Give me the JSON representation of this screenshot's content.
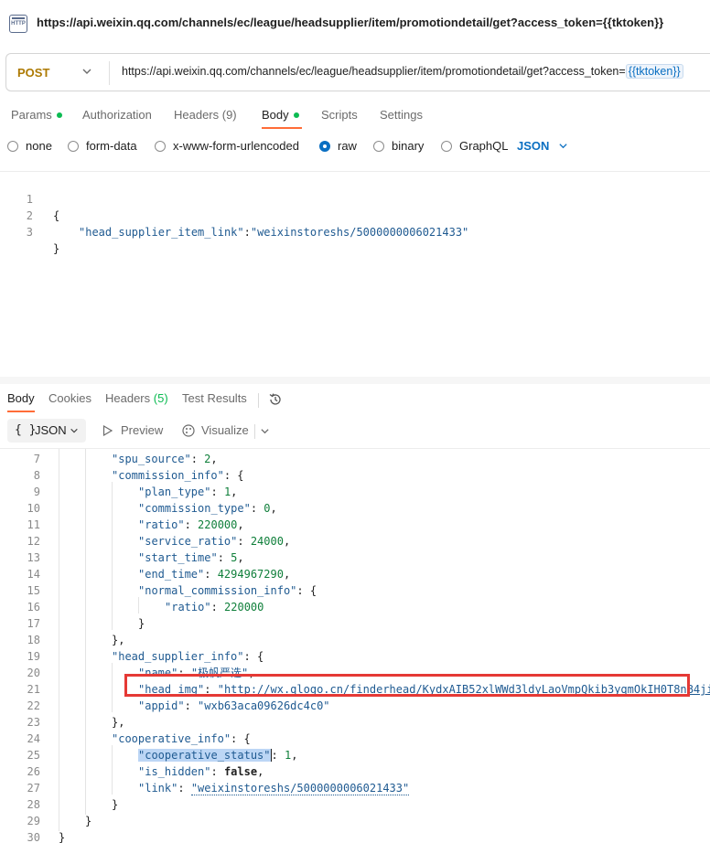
{
  "title": {
    "url": "https://api.weixin.qq.com/channels/ec/league/headsupplier/item/promotiondetail/get?access_token={{tktoken}}"
  },
  "request": {
    "method": "POST",
    "url_prefix": "https://api.weixin.qq.com/channels/ec/league/headsupplier/item/promotiondetail/get?access_token=",
    "url_var": "{{tktoken}}"
  },
  "tabs": [
    {
      "label": "Params"
    },
    {
      "label": "Authorization"
    },
    {
      "label": "Headers (9)"
    },
    {
      "label": "Body"
    },
    {
      "label": "Scripts"
    },
    {
      "label": "Settings"
    }
  ],
  "body_types": [
    "none",
    "form-data",
    "x-www-form-urlencoded",
    "raw",
    "binary",
    "GraphQL"
  ],
  "body_format": "JSON",
  "request_body": {
    "lines": [
      {
        "n": "1",
        "text": "{"
      },
      {
        "n": "2",
        "key": "\"head_supplier_item_link\"",
        "val": "\"weixinstoreshs/5000000006021433\""
      },
      {
        "n": "3",
        "text": "}"
      }
    ]
  },
  "response_tabs": {
    "body": "Body",
    "cookies": "Cookies",
    "headers": "Headers",
    "headers_count": "(5)",
    "tests": "Test Results"
  },
  "response_toolbar": {
    "format_braces": "{ }",
    "format": "JSON",
    "preview": "Preview",
    "visualize": "Visualize"
  },
  "response_lines": [
    {
      "n": "7",
      "indent": 2,
      "key": "\"spu_source\"",
      "val": "2",
      "vt": "num",
      "tail": ","
    },
    {
      "n": "8",
      "indent": 2,
      "key": "\"commission_info\"",
      "val": "{",
      "vt": "punc"
    },
    {
      "n": "9",
      "indent": 3,
      "key": "\"plan_type\"",
      "val": "1",
      "vt": "num",
      "tail": ","
    },
    {
      "n": "10",
      "indent": 3,
      "key": "\"commission_type\"",
      "val": "0",
      "vt": "num",
      "tail": ","
    },
    {
      "n": "11",
      "indent": 3,
      "key": "\"ratio\"",
      "val": "220000",
      "vt": "num",
      "tail": ","
    },
    {
      "n": "12",
      "indent": 3,
      "key": "\"service_ratio\"",
      "val": "24000",
      "vt": "num",
      "tail": ","
    },
    {
      "n": "13",
      "indent": 3,
      "key": "\"start_time\"",
      "val": "5",
      "vt": "num",
      "tail": ","
    },
    {
      "n": "14",
      "indent": 3,
      "key": "\"end_time\"",
      "val": "4294967290",
      "vt": "num",
      "tail": ","
    },
    {
      "n": "15",
      "indent": 3,
      "key": "\"normal_commission_info\"",
      "val": "{",
      "vt": "punc"
    },
    {
      "n": "16",
      "indent": 4,
      "key": "\"ratio\"",
      "val": "220000",
      "vt": "num"
    },
    {
      "n": "17",
      "indent": 3,
      "text": "}"
    },
    {
      "n": "18",
      "indent": 2,
      "text": "},"
    },
    {
      "n": "19",
      "indent": 2,
      "key": "\"head_supplier_info\"",
      "val": "{",
      "vt": "punc"
    },
    {
      "n": "20",
      "indent": 3,
      "key": "\"name\"",
      "val": "\"极帆严选\"",
      "vt": "str",
      "tail": ","
    },
    {
      "n": "21",
      "indent": 3,
      "key": "\"head_img\"",
      "val": "\"http://wx.qlogo.cn/finderhead/KydxAIB52xlWWd3ldyLaoVmpQkib3yqmOkIH0T8nB4ji",
      "vt": "link"
    },
    {
      "n": "22",
      "indent": 3,
      "key": "\"appid\"",
      "val": "\"wxb63aca09626dc4c0\"",
      "vt": "str"
    },
    {
      "n": "23",
      "indent": 2,
      "text": "},"
    },
    {
      "n": "24",
      "indent": 2,
      "key": "\"cooperative_info\"",
      "val": "{",
      "vt": "punc"
    },
    {
      "n": "25",
      "indent": 3,
      "key": "\"cooperative_status\"",
      "val": "1",
      "vt": "num",
      "tail": ",",
      "selected": true
    },
    {
      "n": "26",
      "indent": 3,
      "key": "\"is_hidden\"",
      "val": "false",
      "vt": "bool",
      "tail": ","
    },
    {
      "n": "27",
      "indent": 3,
      "key": "\"link\"",
      "val": "\"weixinstoreshs/5000000006021433\"",
      "vt": "dotted"
    },
    {
      "n": "28",
      "indent": 2,
      "text": "}"
    },
    {
      "n": "29",
      "indent": 1,
      "text": "}"
    },
    {
      "n": "30",
      "indent": 0,
      "text": "}"
    }
  ],
  "colors": {
    "accent": "#ff6c37",
    "method": "#ad7a03",
    "status_dot": "#0cbb52",
    "json_key": "#a31515",
    "json_string": "#1f5a91",
    "json_number": "#0f7f3a",
    "highlight_box": "#e53935"
  },
  "icons": [
    "http-icon",
    "chevron-down-icon",
    "history-icon",
    "play-icon",
    "visualize-icon"
  ]
}
